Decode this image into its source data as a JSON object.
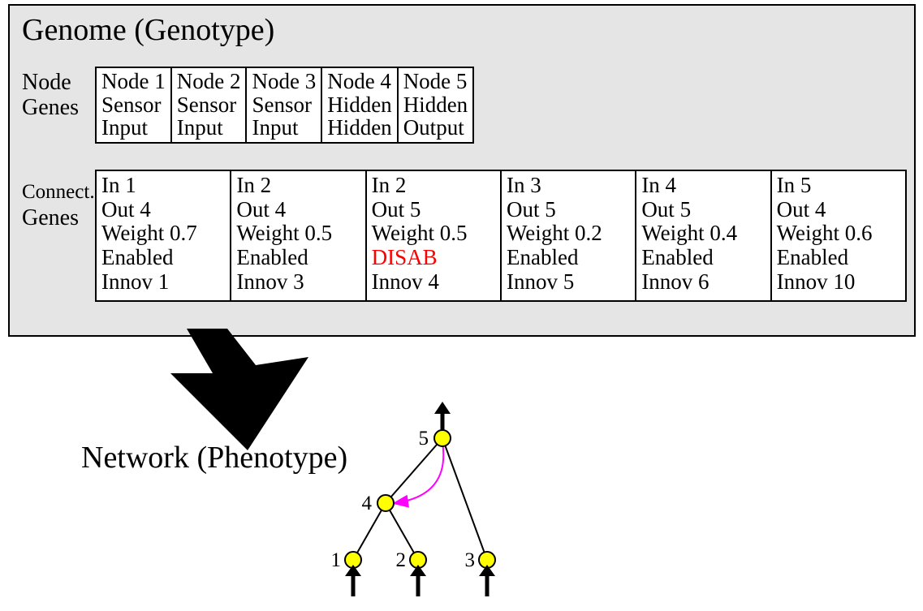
{
  "genome": {
    "title": "Genome (Genotype)",
    "node_genes_label_l1": "Node",
    "node_genes_label_l2": "Genes",
    "connect_genes_label_l1": "Connect.",
    "connect_genes_label_l2": "Genes",
    "node_genes": [
      {
        "l1": "Node 1",
        "l2": "Sensor",
        "l3": "Input"
      },
      {
        "l1": "Node 2",
        "l2": "Sensor",
        "l3": "Input"
      },
      {
        "l1": "Node 3",
        "l2": "Sensor",
        "l3": "Input"
      },
      {
        "l1": "Node 4",
        "l2": "Hidden",
        "l3": "Hidden"
      },
      {
        "l1": "Node 5",
        "l2": "Hidden",
        "l3": "Output"
      }
    ],
    "conn_genes": [
      {
        "in": "In 1",
        "out": "Out 4",
        "weight": "Weight 0.7",
        "status": "Enabled",
        "status_class": "enabled",
        "innov": "Innov 1"
      },
      {
        "in": "In 2",
        "out": "Out 4",
        "weight": "Weight 0.5",
        "status": "Enabled",
        "status_class": "enabled",
        "innov": "Innov 3"
      },
      {
        "in": "In 2",
        "out": "Out 5",
        "weight": "Weight 0.5",
        "status": "DISAB",
        "status_class": "disab",
        "innov": "Innov 4"
      },
      {
        "in": "In 3",
        "out": "Out 5",
        "weight": "Weight 0.2",
        "status": "Enabled",
        "status_class": "enabled",
        "innov": "Innov 5"
      },
      {
        "in": "In 4",
        "out": "Out 5",
        "weight": "Weight 0.4",
        "status": "Enabled",
        "status_class": "enabled",
        "innov": "Innov 6"
      },
      {
        "in": "In 5",
        "out": "Out 4",
        "weight": "Weight 0.6",
        "status": "Enabled",
        "status_class": "enabled",
        "innov": "Innov 10"
      }
    ]
  },
  "network": {
    "title": "Network (Phenotype)",
    "nodes": {
      "n1": "1",
      "n2": "2",
      "n3": "3",
      "n4": "4",
      "n5": "5"
    }
  }
}
